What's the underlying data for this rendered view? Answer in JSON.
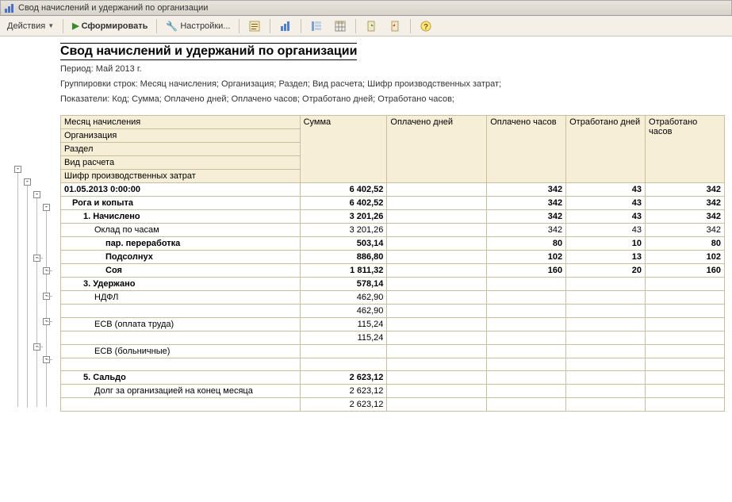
{
  "window": {
    "title": "Свод начислений и удержаний по организации"
  },
  "toolbar": {
    "actions": "Действия",
    "form": "Сформировать",
    "settings": "Настройки..."
  },
  "report": {
    "title": "Свод начислений и удержаний по организации",
    "period": "Период: Май 2013 г.",
    "grouping": "Группировки строк: Месяц начисления; Организация; Раздел; Вид расчета; Шифр производственных затрат;",
    "indicators": "Показатели: Код; Сумма; Оплачено дней; Оплачено часов; Отработано дней; Отработано часов;"
  },
  "headers": {
    "r1": "Месяц начисления",
    "r2": "Организация",
    "r3": "Раздел",
    "r4": "Вид расчета",
    "r5": "Шифр производственных затрат",
    "c1": "Сумма",
    "c2": "Оплачено дней",
    "c3": "Оплачено часов",
    "c4": "Отработано дней",
    "c5": "Отработано часов"
  },
  "rows": [
    {
      "label": "01.05.2013 0:00:00",
      "c1": "6 402,52",
      "c2": "",
      "c3": "342",
      "c4": "43",
      "c5": "342",
      "bold": true,
      "pad": 0
    },
    {
      "label": "Рога и копыта",
      "c1": "6 402,52",
      "c2": "",
      "c3": "342",
      "c4": "43",
      "c5": "342",
      "bold": true,
      "pad": 1
    },
    {
      "label": "1. Начислено",
      "c1": "3 201,26",
      "c2": "",
      "c3": "342",
      "c4": "43",
      "c5": "342",
      "bold": true,
      "pad": 2
    },
    {
      "label": "Оклад по часам",
      "c1": "3 201,26",
      "c2": "",
      "c3": "342",
      "c4": "43",
      "c5": "342",
      "bold": false,
      "pad": 3
    },
    {
      "label": "пар. переработка",
      "c1": "503,14",
      "c2": "",
      "c3": "80",
      "c4": "10",
      "c5": "80",
      "bold": true,
      "pad": 4
    },
    {
      "label": "Подсолнух",
      "c1": "886,80",
      "c2": "",
      "c3": "102",
      "c4": "13",
      "c5": "102",
      "bold": true,
      "pad": 4
    },
    {
      "label": "Соя",
      "c1": "1 811,32",
      "c2": "",
      "c3": "160",
      "c4": "20",
      "c5": "160",
      "bold": true,
      "pad": 4
    },
    {
      "label": "3. Удержано",
      "c1": "578,14",
      "c2": "",
      "c3": "",
      "c4": "",
      "c5": "",
      "bold": true,
      "pad": 2
    },
    {
      "label": "НДФЛ",
      "c1": "462,90",
      "c2": "",
      "c3": "",
      "c4": "",
      "c5": "",
      "bold": false,
      "pad": 3
    },
    {
      "label": "",
      "c1": "462,90",
      "c2": "",
      "c3": "",
      "c4": "",
      "c5": "",
      "bold": false,
      "pad": 4
    },
    {
      "label": "ЕСВ (оплата труда)",
      "c1": "115,24",
      "c2": "",
      "c3": "",
      "c4": "",
      "c5": "",
      "bold": false,
      "pad": 3
    },
    {
      "label": "",
      "c1": "115,24",
      "c2": "",
      "c3": "",
      "c4": "",
      "c5": "",
      "bold": false,
      "pad": 4
    },
    {
      "label": "ЕСВ (больничные)",
      "c1": "",
      "c2": "",
      "c3": "",
      "c4": "",
      "c5": "",
      "bold": false,
      "pad": 3
    },
    {
      "label": "",
      "c1": "",
      "c2": "",
      "c3": "",
      "c4": "",
      "c5": "",
      "bold": false,
      "pad": 4
    },
    {
      "label": "5. Сальдо",
      "c1": "2 623,12",
      "c2": "",
      "c3": "",
      "c4": "",
      "c5": "",
      "bold": true,
      "pad": 2
    },
    {
      "label": "Долг за организацией на конец месяца",
      "c1": "2 623,12",
      "c2": "",
      "c3": "",
      "c4": "",
      "c5": "",
      "bold": false,
      "pad": 3
    },
    {
      "label": "",
      "c1": "2 623,12",
      "c2": "",
      "c3": "",
      "c4": "",
      "c5": "",
      "bold": false,
      "pad": 4
    }
  ],
  "icons": {
    "app": "chart-icon"
  }
}
